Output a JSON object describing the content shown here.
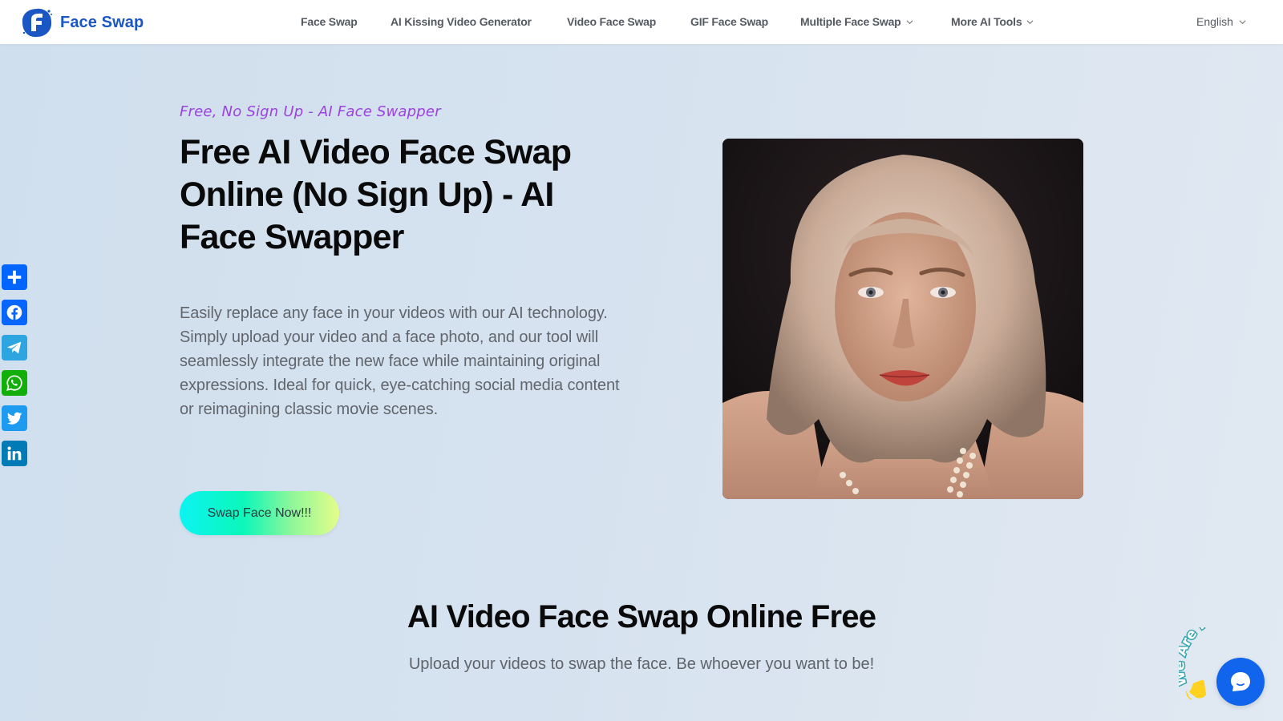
{
  "header": {
    "brand": "Face Swap",
    "nav": [
      {
        "label": "Face Swap",
        "dropdown": false
      },
      {
        "label": "AI Kissing Video Generator",
        "dropdown": false
      },
      {
        "label": "Video Face Swap",
        "dropdown": false
      },
      {
        "label": "GIF Face Swap",
        "dropdown": false
      },
      {
        "label": "Multiple Face Swap",
        "dropdown": true
      },
      {
        "label": "More AI Tools",
        "dropdown": true
      }
    ],
    "language": "English"
  },
  "hero": {
    "tagline": "Free, No Sign Up - AI Face Swapper",
    "title": "Free AI Video Face Swap Online (No Sign Up) - AI Face Swapper",
    "description": "Easily replace any face in your videos with our AI technology. Simply upload your video and a face photo, and our tool will seamlessly integrate the new face while maintaining original expressions. Ideal for quick, eye-catching social media content or reimagining classic movie scenes.",
    "cta_label": "Swap Face Now!!!",
    "image_alt": "Portrait of a woman with wavy blonde hair and pearl necklace"
  },
  "section": {
    "title": "AI Video Face Swap Online Free",
    "subtitle": "Upload your videos to swap the face. Be whoever you want to be!"
  },
  "share": [
    {
      "name": "share",
      "icon": "plus-icon",
      "color": "#0166ff"
    },
    {
      "name": "facebook",
      "icon": "facebook-icon",
      "color": "#0866ff"
    },
    {
      "name": "telegram",
      "icon": "telegram-icon",
      "color": "#2ca5e0"
    },
    {
      "name": "whatsapp",
      "icon": "whatsapp-icon",
      "color": "#12af0a"
    },
    {
      "name": "twitter",
      "icon": "twitter-icon",
      "color": "#1d9bf0"
    },
    {
      "name": "linkedin",
      "icon": "linkedin-icon",
      "color": "#007bb5"
    }
  ],
  "chat": {
    "label": "We Are Here!",
    "button_color": "#1065ec"
  },
  "colors": {
    "brand": "#1a56c4",
    "tagline": "#9b42e0"
  }
}
